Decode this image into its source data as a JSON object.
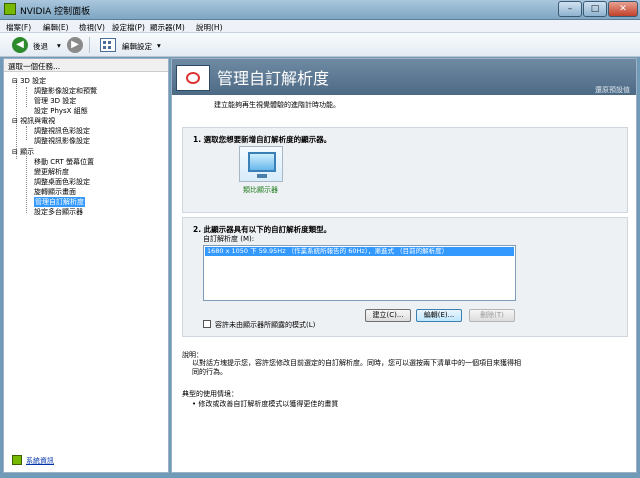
{
  "window": {
    "title": "NVIDIA 控制面板"
  },
  "menu": [
    "檔案(F)",
    "編輯(E)",
    "檢視(V)",
    "設定檔(P)",
    "顯示器(M)",
    "說明(H)"
  ],
  "toolbar": {
    "back_label": "後退",
    "edit_label": "編輯設定"
  },
  "sidebar": {
    "header": "選取一個任務...",
    "groups": [
      {
        "label": "3D 設定",
        "items": [
          "調整影像設定和預覽",
          "管理 3D 設定",
          "設定 PhysX 組態"
        ]
      },
      {
        "label": "視訊與電視",
        "items": [
          "調整視訊色彩設定",
          "調整視訊影像設定"
        ]
      },
      {
        "label": "顯示",
        "items": [
          "移動 CRT 螢幕位置",
          "變更解析度",
          "調整桌面色彩設定",
          "旋轉顯示畫面",
          "管理自訂解析度",
          "設定多台顯示器"
        ]
      }
    ],
    "system_info": "系統資訊"
  },
  "main": {
    "title": "管理自訂解析度",
    "restore": "還原預設值",
    "description": "建立能夠再生視覺體驗的進階計時功能。",
    "section1_title": "1. 選取您想要新增自訂解析度的顯示器。",
    "monitor_label": "類比顯示器",
    "section2_title": "2. 此顯示器具有以下的自訂解析度類型。",
    "list_label": "自訂解析度 (M):",
    "resolution_item": "1680 x 1050 下 59.95Hz （作業系統所報告的 60Hz），漸進式 （目前的解析度）",
    "create_button": "建立(C)...",
    "edit_button": "編輯(E)...",
    "delete_button": "刪除(T)",
    "checkbox_label": "容許未由顯示器所顯露的模式(L)",
    "explain_title": "說明：",
    "explain_text": "以對話方塊提示您，容許您修改目前選定的自訂解析度。同時，您可以選按兩下清單中的一個項目來獲得相同的行為。",
    "usage_title": "典型的使用情境：",
    "usage_text": "• 修改或改善自訂解析度模式以獲得更佳的畫質"
  }
}
